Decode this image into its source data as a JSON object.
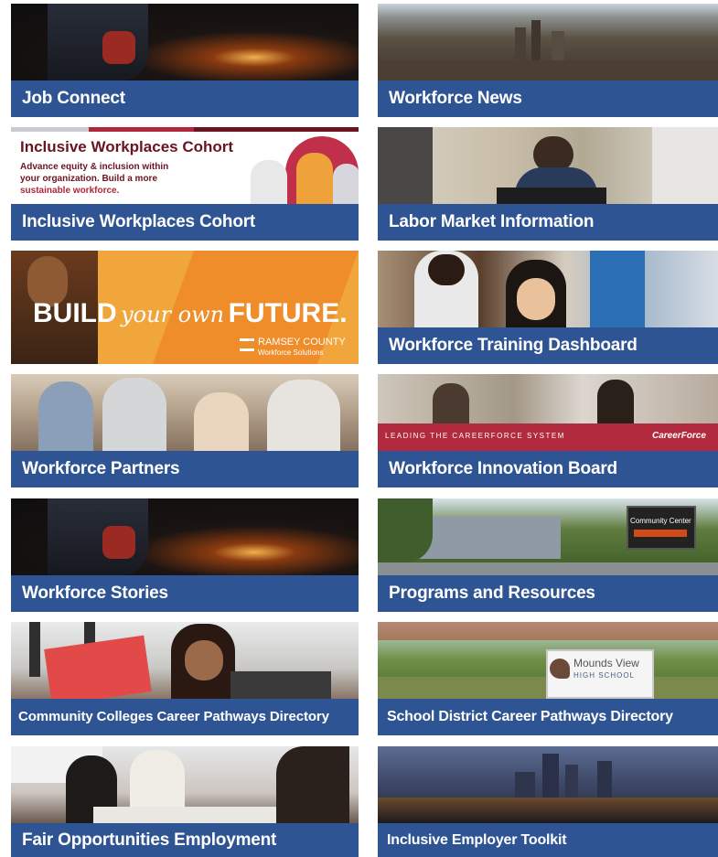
{
  "tiles": [
    {
      "label": "Job Connect",
      "image_icon": "sparks-image"
    },
    {
      "label": "Workforce News",
      "image_icon": "city-skyline-image"
    },
    {
      "label": "Inclusive Workplaces Cohort",
      "image_icon": "cohort-banner-image"
    },
    {
      "label": "Labor Market Information",
      "image_icon": "office-worker-image"
    },
    {
      "label": "",
      "image_icon": "build-your-future-banner"
    },
    {
      "label": "Workforce Training Dashboard",
      "image_icon": "lab-worker-image"
    },
    {
      "label": "Workforce Partners",
      "image_icon": "meeting-image"
    },
    {
      "label": "Workforce Innovation Board",
      "image_icon": "board-meeting-image"
    },
    {
      "label": "Workforce Stories",
      "image_icon": "sparks-image"
    },
    {
      "label": "Programs and Resources",
      "image_icon": "community-center-image"
    },
    {
      "label": "Community Colleges Career Pathways Directory",
      "image_icon": "student-phone-image"
    },
    {
      "label": "School District Career Pathways Directory",
      "image_icon": "high-school-sign-image"
    },
    {
      "label": "Fair Opportunities Employment",
      "image_icon": "team-meeting-image"
    },
    {
      "label": "Inclusive Employer Toolkit",
      "image_icon": "night-city-image"
    }
  ],
  "cohort_banner": {
    "heading": "Inclusive Workplaces Cohort",
    "line1": "Advance equity & inclusion within",
    "line2": "your organization. Build a more",
    "line3": "sustainable workforce."
  },
  "build_banner": {
    "build": "BUILD",
    "your_own": "your own",
    "future": "FUTURE.",
    "logo_name": "RAMSEY COUNTY",
    "logo_sub": "Workforce Solutions"
  },
  "board_banner": {
    "strip_text": "LEADING THE CAREERFORCE SYSTEM",
    "logo_right": "CareerForce"
  },
  "center_sign": {
    "title": "Community Center"
  },
  "school_sign": {
    "line1": "Mounds View",
    "line2": "HIGH SCHOOL"
  },
  "colors": {
    "label_bg": "#2f5494",
    "label_text": "#ffffff",
    "build_bg": "#f0a63a",
    "cohort_red": "#b0273a",
    "board_strip": "#b22a3d"
  }
}
